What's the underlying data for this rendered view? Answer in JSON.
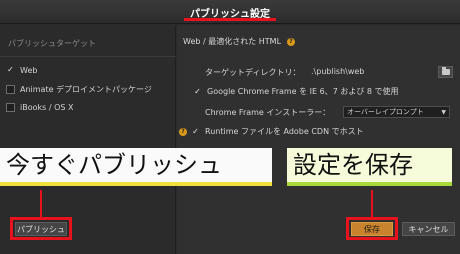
{
  "dialog": {
    "title": "パブリッシュ設定"
  },
  "left": {
    "header": "パブリッシュターゲット",
    "targets": [
      {
        "label": "Web",
        "checked": true
      },
      {
        "label": "Animate デプロイメントパッケージ",
        "checked": false
      },
      {
        "label": "iBooks / OS X",
        "checked": false
      }
    ]
  },
  "right": {
    "title": "Web / 最適化された HTML",
    "help_glyph": "?",
    "target_dir_label": "ターゲットディレクトリ：",
    "target_dir_value": ".\\publish\\web",
    "chrome_frame_ie_label": "Google Chrome Frame を IE 6、7 および 8 で使用",
    "chrome_frame_installer_label": "Chrome Frame インストーラー：",
    "installer_option": "オーバーレイプロンプト",
    "cdn_label": "Runtime ファイルを Adobe CDN でホスト"
  },
  "annotations": {
    "publish_now": "今すぐパブリッシュ",
    "save_settings": "設定を保存"
  },
  "buttons": {
    "publish": "パブリッシュ",
    "save": "保存",
    "cancel": "キャンセル"
  },
  "colors": {
    "highlight_red": "#e8121d",
    "annotation_yellow": "#f1e23a",
    "annotation_green": "#a8d83a",
    "help_orange": "#d99a1a"
  },
  "icons": {
    "checkmark": "check-icon",
    "help": "help-icon",
    "folder": "folder-icon",
    "dropdown": "chevron-down-icon"
  }
}
